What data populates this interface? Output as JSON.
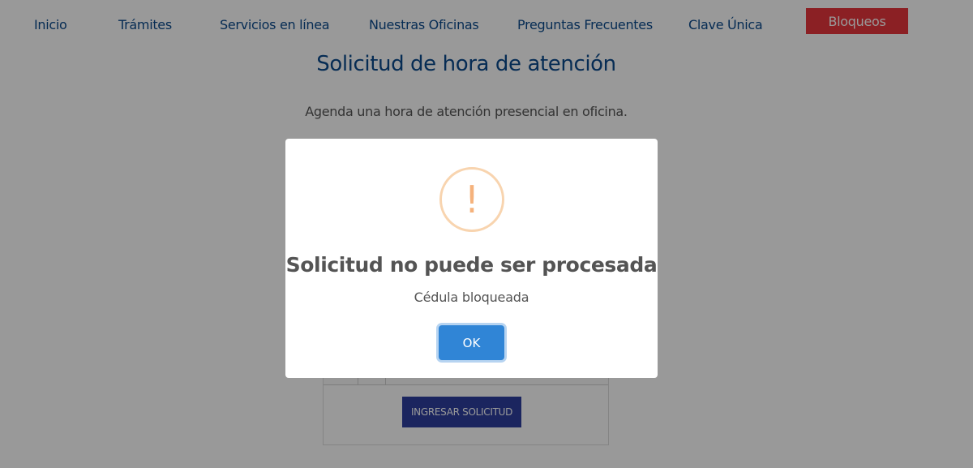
{
  "nav": {
    "items": [
      "Inicio",
      "Trámites",
      "Servicios en línea",
      "Nuestras Oficinas",
      "Preguntas Frecuentes",
      "Clave Única"
    ],
    "bloqueos_label": "Bloqueos"
  },
  "page": {
    "title": "Solicitud de hora de atención",
    "subtitle": "Agenda una hora de atención presencial en oficina.",
    "submit_label": "INGRESAR SOLICITUD"
  },
  "modal": {
    "icon": "exclamation-icon",
    "icon_glyph": "!",
    "title": "Solicitud no puede ser procesada",
    "text": "Cédula bloqueada",
    "ok_label": "OK"
  },
  "colors": {
    "nav_text": "#0b4a8c",
    "bloqueos_bg": "#e8363d",
    "ok_button": "#3085d6",
    "warning": "#f8bb86",
    "submit_bg": "#2e3f9e"
  }
}
